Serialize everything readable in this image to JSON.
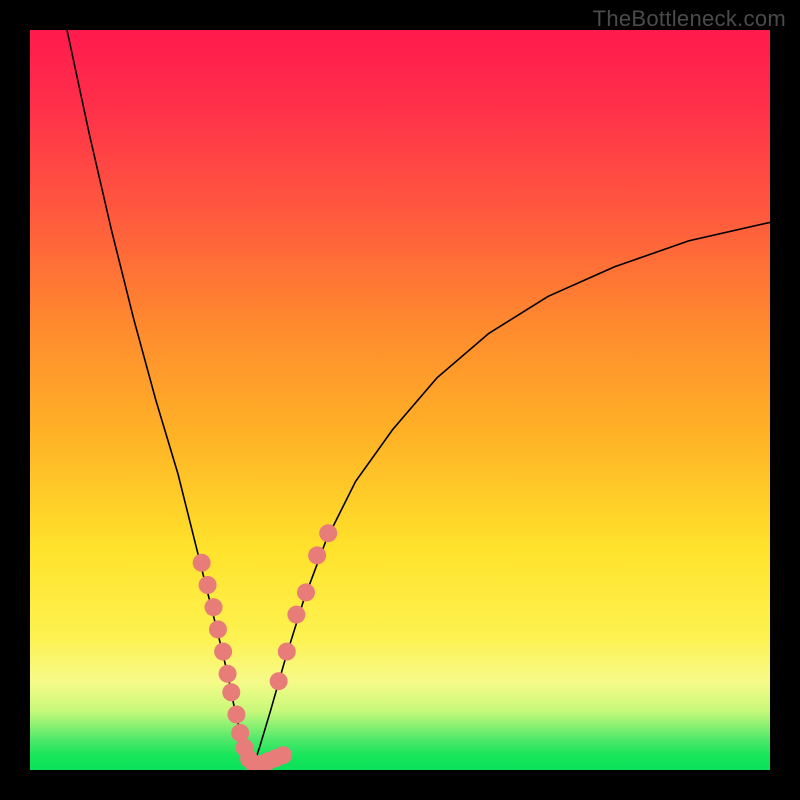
{
  "watermark": "TheBottleneck.com",
  "chart_data": {
    "type": "line",
    "title": "",
    "xlabel": "",
    "ylabel": "",
    "xlim": [
      0,
      100
    ],
    "ylim": [
      0,
      100
    ],
    "background": "rainbow-vertical",
    "series": [
      {
        "name": "left-curve",
        "x": [
          5,
          8,
          11,
          14,
          17,
          20,
          22,
          24,
          25.5,
          26.7,
          27.5,
          28.2,
          28.8,
          29.3,
          29.7,
          30
        ],
        "y": [
          100,
          86,
          73,
          61,
          50,
          40,
          32,
          24,
          18,
          13,
          9,
          6,
          4,
          2,
          1,
          0
        ]
      },
      {
        "name": "right-curve",
        "x": [
          30,
          31,
          32.5,
          34.5,
          37,
          40,
          44,
          49,
          55,
          62,
          70,
          79,
          89,
          100
        ],
        "y": [
          0,
          3,
          8,
          15,
          23,
          31,
          39,
          46,
          53,
          59,
          64,
          68,
          71.5,
          74
        ]
      }
    ],
    "scatter": {
      "name": "data-dots",
      "color": "#e77c78",
      "points": [
        {
          "x": 23.2,
          "y": 28
        },
        {
          "x": 24.0,
          "y": 25
        },
        {
          "x": 24.8,
          "y": 22
        },
        {
          "x": 25.4,
          "y": 19
        },
        {
          "x": 26.1,
          "y": 16
        },
        {
          "x": 26.7,
          "y": 13
        },
        {
          "x": 27.2,
          "y": 10.5
        },
        {
          "x": 27.9,
          "y": 7.5
        },
        {
          "x": 28.4,
          "y": 5
        },
        {
          "x": 29.0,
          "y": 3
        },
        {
          "x": 29.6,
          "y": 1.5
        },
        {
          "x": 30.3,
          "y": 0.8
        },
        {
          "x": 31.2,
          "y": 0.8
        },
        {
          "x": 32.2,
          "y": 1.2
        },
        {
          "x": 33.2,
          "y": 1.6
        },
        {
          "x": 34.2,
          "y": 2.0
        },
        {
          "x": 33.6,
          "y": 12
        },
        {
          "x": 34.7,
          "y": 16
        },
        {
          "x": 36.0,
          "y": 21
        },
        {
          "x": 37.3,
          "y": 24
        },
        {
          "x": 38.8,
          "y": 29
        },
        {
          "x": 40.3,
          "y": 32
        }
      ]
    }
  }
}
